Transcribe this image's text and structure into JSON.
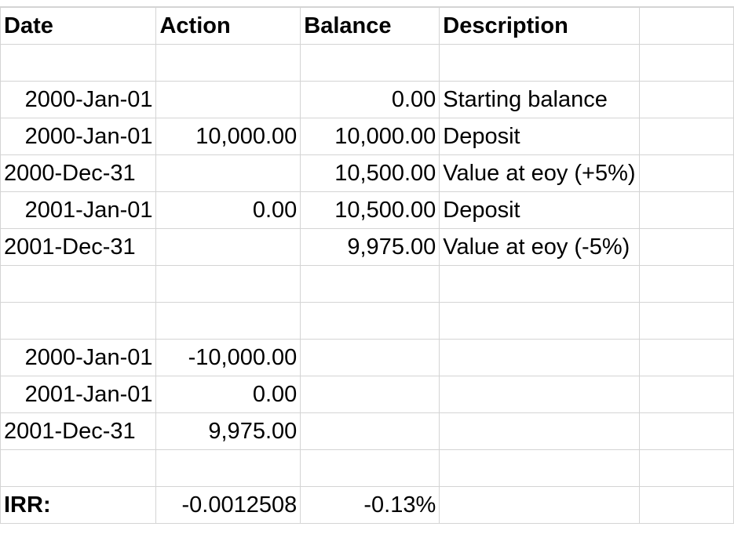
{
  "headers": {
    "date": "Date",
    "action": "Action",
    "balance": "Balance",
    "description": "Description"
  },
  "rows": [
    {
      "date": "2000-Jan-01",
      "action": "",
      "balance": "0.00",
      "description": "Starting balance"
    },
    {
      "date": "2000-Jan-01",
      "action": "10,000.00",
      "balance": "10,000.00",
      "description": "Deposit"
    },
    {
      "date": "2000-Dec-31",
      "action": "",
      "balance": "10,500.00",
      "description": "Value at eoy (+5%)"
    },
    {
      "date": "2001-Jan-01",
      "action": "0.00",
      "balance": "10,500.00",
      "description": "Deposit"
    },
    {
      "date": "2001-Dec-31",
      "action": "",
      "balance": "9,975.00",
      "description": "Value at eoy (-5%)"
    }
  ],
  "cashflows": [
    {
      "date": "2000-Jan-01",
      "amount": "-10,000.00"
    },
    {
      "date": "2001-Jan-01",
      "amount": "0.00"
    },
    {
      "date": "2001-Dec-31",
      "amount": "9,975.00"
    }
  ],
  "irr": {
    "label": "IRR:",
    "value": "-0.0012508",
    "percent": "-0.13%"
  }
}
